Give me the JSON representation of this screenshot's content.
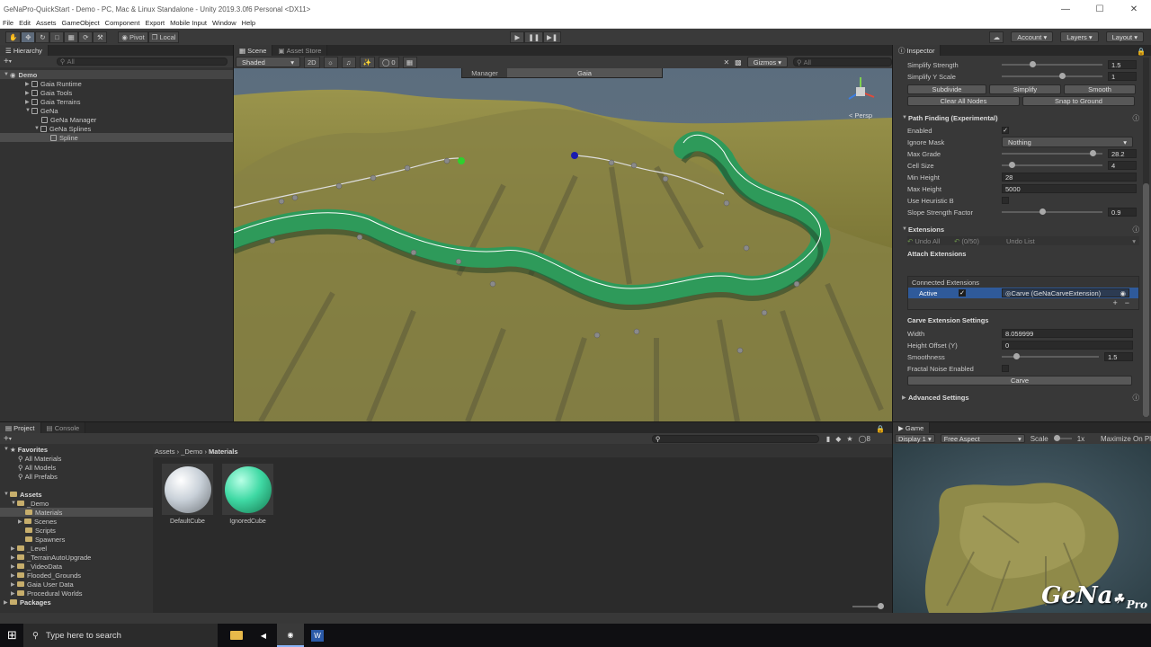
{
  "window": {
    "title": "GeNaPro-QuickStart - Demo - PC, Mac & Linux Standalone - Unity 2019.3.0f6 Personal <DX11>"
  },
  "menu": [
    "File",
    "Edit",
    "Assets",
    "GameObject",
    "Component",
    "Export",
    "Mobile Input",
    "Window",
    "Help"
  ],
  "toolbar": {
    "pivot": "Pivot",
    "local": "Local",
    "account": "Account",
    "layers": "Layers",
    "layout": "Layout"
  },
  "hierarchy": {
    "tab": "Hierarchy",
    "search_placeholder": "All",
    "items": [
      {
        "label": "Demo",
        "depth": 0
      },
      {
        "label": "Gaia Runtime",
        "depth": 1
      },
      {
        "label": "Gaia Tools",
        "depth": 1
      },
      {
        "label": "Gaia Terrains",
        "depth": 1
      },
      {
        "label": "GeNa",
        "depth": 1
      },
      {
        "label": "GeNa Manager",
        "depth": 2
      },
      {
        "label": "GeNa Splines",
        "depth": 2
      },
      {
        "label": "Spline",
        "depth": 3
      }
    ]
  },
  "scene": {
    "tabs": [
      "Scene",
      "Asset Store"
    ],
    "shading": "Shaded",
    "mode2d": "2D",
    "hidden_count": "0",
    "gizmos": "Gizmos",
    "search_placeholder": "All",
    "overlay_tabs": [
      "Manager",
      "Gaia"
    ],
    "persp": "< Persp"
  },
  "inspector": {
    "tab": "Inspector",
    "simplify_strength": {
      "label": "Simplify Strength",
      "value": "1.5",
      "level": 0.3
    },
    "simplify_y_scale": {
      "label": "Simplify Y Scale",
      "value": "1",
      "level": 0.6
    },
    "buttons_row1": [
      "Subdivide",
      "Simplify",
      "Smooth"
    ],
    "buttons_row2": [
      "Clear All Nodes",
      "Snap to Ground"
    ],
    "path_finding": {
      "header": "Path Finding (Experimental)",
      "enabled": "Enabled",
      "ignore_mask": "Ignore Mask",
      "ignore_mask_value": "Nothing",
      "max_grade": "Max Grade",
      "max_grade_value": "28.2",
      "max_grade_level": 0.9,
      "cell_size": "Cell Size",
      "cell_size_value": "4",
      "cell_size_level": 0.1,
      "min_height": "Min Height",
      "min_height_value": "28",
      "max_height": "Max Height",
      "max_height_value": "5000",
      "use_heuristic": "Use Heuristic B",
      "slope": "Slope Strength Factor",
      "slope_value": "0.9",
      "slope_level": 0.4
    },
    "extensions": {
      "header": "Extensions",
      "undo_all": "Undo All",
      "count": "(0/50)",
      "undo_list": "Undo List",
      "attach": "Attach Extensions",
      "connected": "Connected Extensions",
      "active": "Active",
      "carve_ext": "Carve (GeNaCarveExtension)"
    },
    "carve": {
      "header": "Carve Extension Settings",
      "width": "Width",
      "width_value": "8.059999",
      "height_offset": "Height Offset (Y)",
      "height_offset_value": "0",
      "smoothness": "Smoothness",
      "smoothness_value": "1.5",
      "smoothness_level": 0.15,
      "fractal": "Fractal Noise Enabled",
      "button": "Carve"
    },
    "advanced": "Advanced Settings"
  },
  "project": {
    "tabs": [
      "Project",
      "Console"
    ],
    "favorites": {
      "label": "Favorites",
      "items": [
        "All Materials",
        "All Models",
        "All Prefabs"
      ]
    },
    "assets_label": "Assets",
    "tree": [
      {
        "label": "_Demo",
        "depth": 1
      },
      {
        "label": "Materials",
        "depth": 2
      },
      {
        "label": "Scenes",
        "depth": 2
      },
      {
        "label": "Scripts",
        "depth": 2
      },
      {
        "label": "Spawners",
        "depth": 2
      },
      {
        "label": "_Level",
        "depth": 1
      },
      {
        "label": "_TerrainAutoUpgrade",
        "depth": 1
      },
      {
        "label": "_VideoData",
        "depth": 1
      },
      {
        "label": "Flooded_Grounds",
        "depth": 1
      },
      {
        "label": "Gaia User Data",
        "depth": 1
      },
      {
        "label": "Procedural Worlds",
        "depth": 1
      }
    ],
    "packages": "Packages",
    "breadcrumb": [
      "Assets",
      "_Demo",
      "Materials"
    ],
    "materials": [
      {
        "name": "DefaultCube",
        "color": "#c8d0d8"
      },
      {
        "name": "IgnoredCube",
        "color": "#3fd9a4"
      }
    ],
    "filter_count": "8"
  },
  "game": {
    "tab": "Game",
    "display": "Display 1",
    "aspect": "Free Aspect",
    "scale_label": "Scale",
    "scale_value": "1x",
    "maximize": "Maximize On Pl",
    "logo": "GeNa",
    "logo_suffix": "Pro"
  },
  "taskbar": {
    "search_placeholder": "Type here to search"
  },
  "colors": {
    "accent": "#3e5f96",
    "spline_green": "#2e9a5a",
    "terrain": "#8d8a3e"
  }
}
